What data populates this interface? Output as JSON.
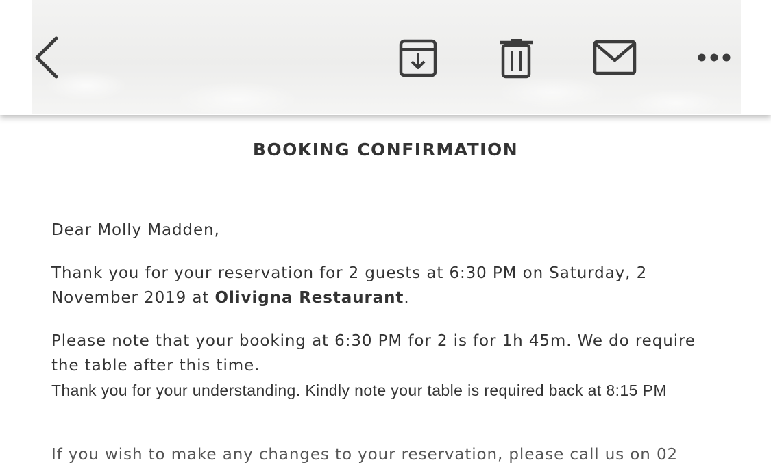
{
  "toolbar": {
    "back_icon": "chevron-left-icon",
    "archive_icon": "archive-icon",
    "trash_icon": "trash-icon",
    "mail_icon": "mail-icon",
    "more_icon": "more-horizontal-icon",
    "icon_color": "#3c3c3c"
  },
  "email": {
    "title": "BOOKING CONFIRMATION",
    "greeting": "Dear Molly Madden,",
    "thanks_prefix": "Thank you for your reservation for 2 guests at 6:30 PM on Saturday, 2 November 2019 at ",
    "restaurant": "Olivigna Restaurant",
    "thanks_suffix": ".",
    "note": "Please note that your booking at 6:30 PM for 2 is for 1h 45m. We do require the table after this time.",
    "understanding": "Thank you for your understanding. Kindly note your table is required back at 8:15 PM",
    "cut_line": "If you wish to make any changes to your reservation, please call us on 02"
  },
  "colors": {
    "text": "#333333",
    "background": "#ffffff"
  }
}
